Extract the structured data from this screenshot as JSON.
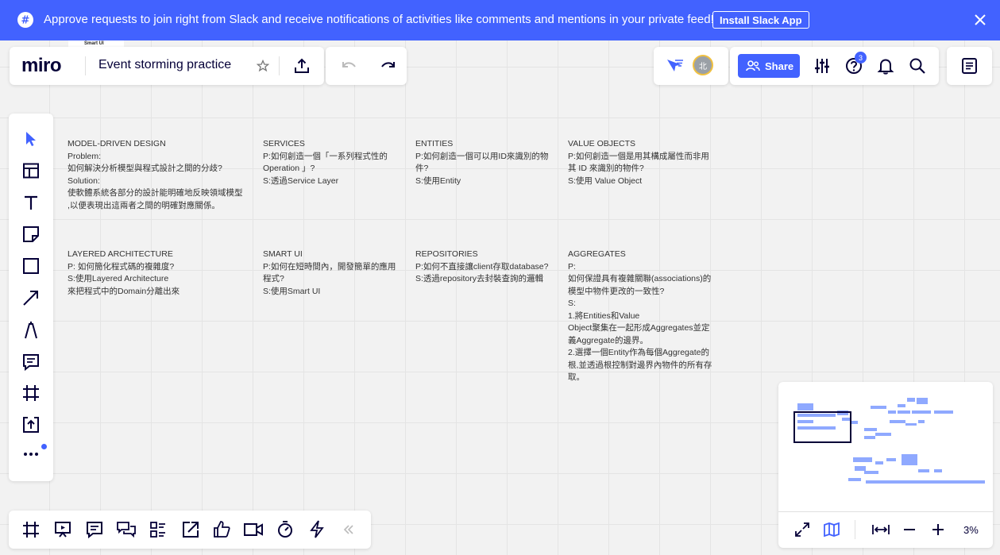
{
  "banner": {
    "message": "Approve requests to join right from Slack and receive notifications of activities like comments and mentions in your private feed!",
    "install_label": "Install Slack App",
    "color": "#4262ff"
  },
  "tiny_frame_label": "Smart UI",
  "topbar": {
    "logo": "miro",
    "board_title": "Event storming practice"
  },
  "collab": {
    "avatar_initial": "北"
  },
  "right_toolbar": {
    "share_label": "Share",
    "help_badge": "3"
  },
  "minimap": {
    "zoom_level": "3%"
  },
  "board": {
    "sections": [
      {
        "title": "MODEL-DRIVEN DESIGN",
        "lines": [
          "Problem:",
          "如何解決分析模型與程式設計之間的分歧?",
          "Solution:",
          "使軟體系統各部分的設計能明確地反映領域模型",
          ",以便表現出這兩者之間的明確對應關係。"
        ]
      },
      {
        "title": "SERVICES",
        "lines": [
          "P:如何創造一個「一系列程式性的",
          "Operation 」?",
          "S:透過Service Layer"
        ]
      },
      {
        "title": "ENTITIES",
        "lines": [
          "P:如何創造一個可以用ID來識別的物",
          "件?",
          "S:使用Entity"
        ]
      },
      {
        "title": "VALUE OBJECTS",
        "lines": [
          "P:如何創造一個是用其構成屬性而非用",
          "其 ID 來識別的物件?",
          "S:使用 Value Object"
        ]
      },
      {
        "title": "LAYERED ARCHITECTURE",
        "lines": [
          "P: 如何簡化程式碼的複雜度?",
          "S:使用Layered Architecture",
          "來把程式中的Domain分離出來"
        ]
      },
      {
        "title": "SMART UI",
        "lines": [
          "P:如何在短時間內，開發簡單的應用",
          "程式?",
          "S:使用Smart UI"
        ]
      },
      {
        "title": "REPOSITORIES",
        "lines": [
          "P:如何不直接讓client存取database?",
          "S:透過repository去封裝查詢的邏輯"
        ]
      },
      {
        "title": "AGGREGATES",
        "lines": [
          "P:",
          "如何保證具有複雜關聯(associations)的",
          "模型中物件更改的一致性?",
          "S:",
          "1.將Entities和Value",
          "Object聚集在一起形成Aggregates並定",
          "義Aggregate的邊界。",
          "2.選擇一個Entity作為每個Aggregate的",
          "根,並透過根控制對邊界內物件的所有存",
          "取。"
        ]
      }
    ]
  }
}
